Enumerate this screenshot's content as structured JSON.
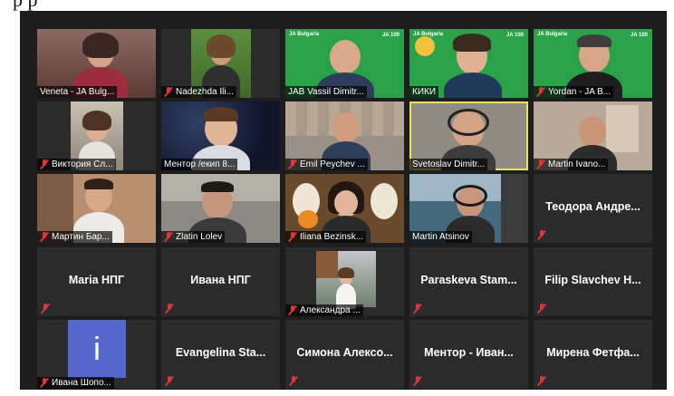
{
  "header_text": "p                                          p",
  "colors": {
    "background": "#1d1d1d",
    "tile": "#2b2b2b",
    "active_border": "#e8e35a",
    "mute": "#e0353b",
    "ja_green": "#2aa24a"
  },
  "participants": [
    {
      "name": "Veneta - JA Bulg...",
      "muted": false,
      "video": true
    },
    {
      "name": "Nadezhda Ili...",
      "muted": true,
      "video": true
    },
    {
      "name": "JAB Vassil Dimitr...",
      "muted": false,
      "video": true,
      "background": "JA Bulgaria",
      "badge": "JA 100"
    },
    {
      "name": "КИКИ",
      "muted": false,
      "video": true,
      "background": "JA Bulgaria",
      "badge": "JA 100"
    },
    {
      "name": "Yordan - JA B...",
      "muted": true,
      "video": true,
      "background": "JA Bulgaria",
      "badge": "JA 100"
    },
    {
      "name": "Виктория Сл...",
      "muted": true,
      "video": true
    },
    {
      "name": "Ментор /екип 8...",
      "muted": false,
      "video": true
    },
    {
      "name": "Emil Peychev ...",
      "muted": true,
      "video": true
    },
    {
      "name": "Svetoslav Dimitr...",
      "muted": false,
      "video": true,
      "active_speaker": true
    },
    {
      "name": "Martin Ivano...",
      "muted": true,
      "video": true
    },
    {
      "name": "Мартин Бар...",
      "muted": true,
      "video": true
    },
    {
      "name": "Zlatin Lolev",
      "muted": true,
      "video": true
    },
    {
      "name": "Iliana Bezinsk...",
      "muted": true,
      "video": true
    },
    {
      "name": "Martin Atsinov",
      "muted": false,
      "video": true
    },
    {
      "name": "Теодора Андре...",
      "muted": true,
      "video": false
    },
    {
      "name": "Maria НПГ",
      "muted": true,
      "video": false
    },
    {
      "name": "Ивана НПГ",
      "muted": true,
      "video": false
    },
    {
      "name": "Александра ...",
      "muted": true,
      "video": true
    },
    {
      "name": "Paraskeva Stam...",
      "muted": true,
      "video": false
    },
    {
      "name": "Filip Slavchev Н...",
      "muted": true,
      "video": false
    },
    {
      "name": "Ивана Шопо...",
      "muted": true,
      "video": true,
      "avatar_letter": "i"
    },
    {
      "name": "Evangelina Sta...",
      "muted": true,
      "video": false
    },
    {
      "name": "Симона Алексо...",
      "muted": true,
      "video": false
    },
    {
      "name": "Ментор - Иван...",
      "muted": true,
      "video": false
    },
    {
      "name": "Мирена Фетфа...",
      "muted": true,
      "video": false
    }
  ]
}
